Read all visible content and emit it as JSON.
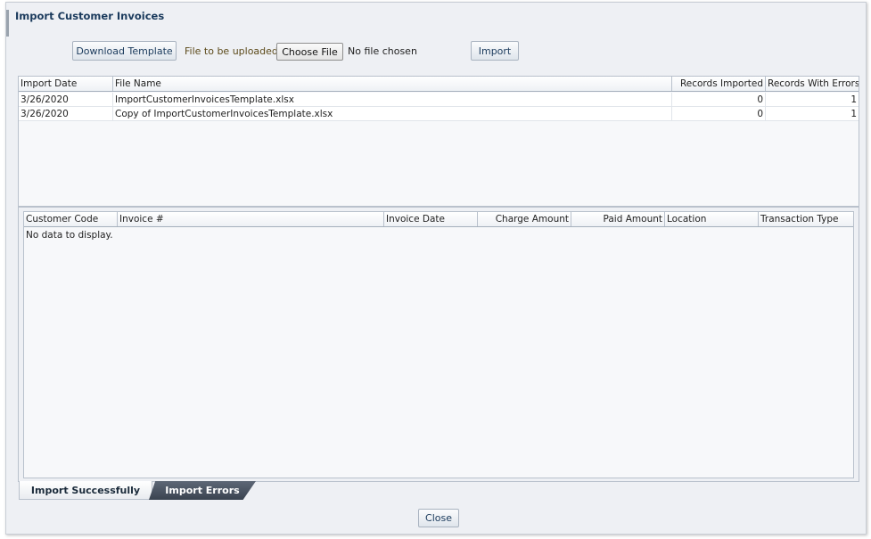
{
  "dialog": {
    "title": "Import Customer Invoices"
  },
  "toolbar": {
    "download_label": "Download Template",
    "file_label": "File to be uploaded",
    "choose_label": "Choose File",
    "no_file_text": "No file chosen",
    "import_label": "Import"
  },
  "imports_table": {
    "headers": [
      "Import Date",
      "File Name",
      "Records Imported",
      "Records With Errors"
    ],
    "rows": [
      {
        "date": "3/26/2020",
        "file": "ImportCustomerInvoicesTemplate.xlsx",
        "imported": "0",
        "errors": "1"
      },
      {
        "date": "3/26/2020",
        "file": "Copy of ImportCustomerInvoicesTemplate.xlsx",
        "imported": "0",
        "errors": "1"
      }
    ]
  },
  "details_table": {
    "headers": [
      "Customer Code",
      "Invoice #",
      "Invoice Date",
      "Charge Amount",
      "Paid Amount",
      "Location",
      "Transaction Type"
    ],
    "empty_text": "No data to display."
  },
  "tabs": [
    {
      "label": "Import Successfully",
      "active": true
    },
    {
      "label": "Import Errors",
      "active": false
    }
  ],
  "footer": {
    "close_label": "Close"
  }
}
